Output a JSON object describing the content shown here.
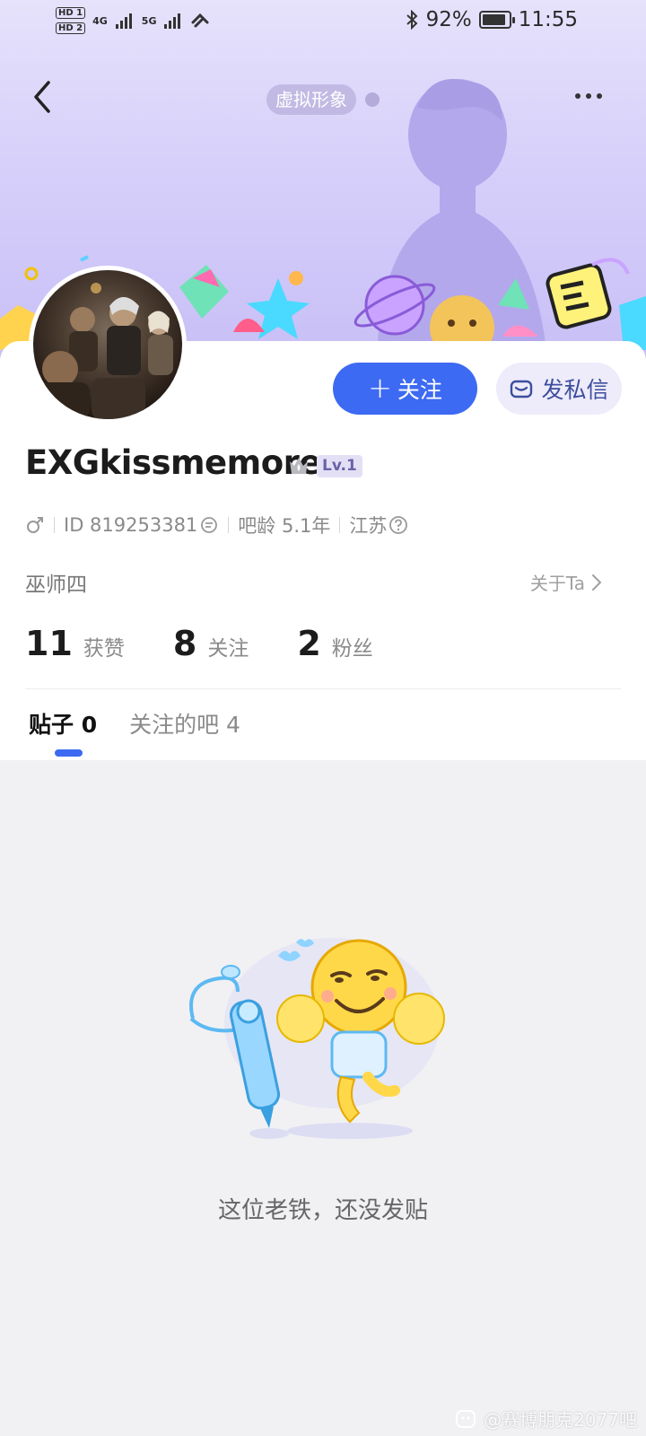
{
  "status_bar": {
    "hd1": "HD 1",
    "hd2": "HD 2",
    "net1": "4G",
    "net2": "5G",
    "battery_pct": "92%",
    "battery_level": 0.92,
    "time": "11:55"
  },
  "header": {
    "avatar_chip": "虚拟形象"
  },
  "profile": {
    "username": "EXGkissmemore",
    "level": "Lv.1",
    "id_label": "ID 819253381",
    "bar_age": "吧龄 5.1年",
    "location": "江苏",
    "signature": "巫师四",
    "about": "关于Ta"
  },
  "actions": {
    "follow": "关注",
    "message": "发私信"
  },
  "stats": [
    {
      "num": "11",
      "label": "获赞"
    },
    {
      "num": "8",
      "label": "关注"
    },
    {
      "num": "2",
      "label": "粉丝"
    }
  ],
  "tabs": {
    "posts": "贴子 0",
    "followed_bars": "关注的吧 4"
  },
  "empty_state": {
    "text": "这位老铁，还没发贴"
  },
  "watermark": "@赛博朋克2077吧",
  "colors": {
    "accent": "#3d6af2",
    "banner": "#d7d0fa"
  }
}
